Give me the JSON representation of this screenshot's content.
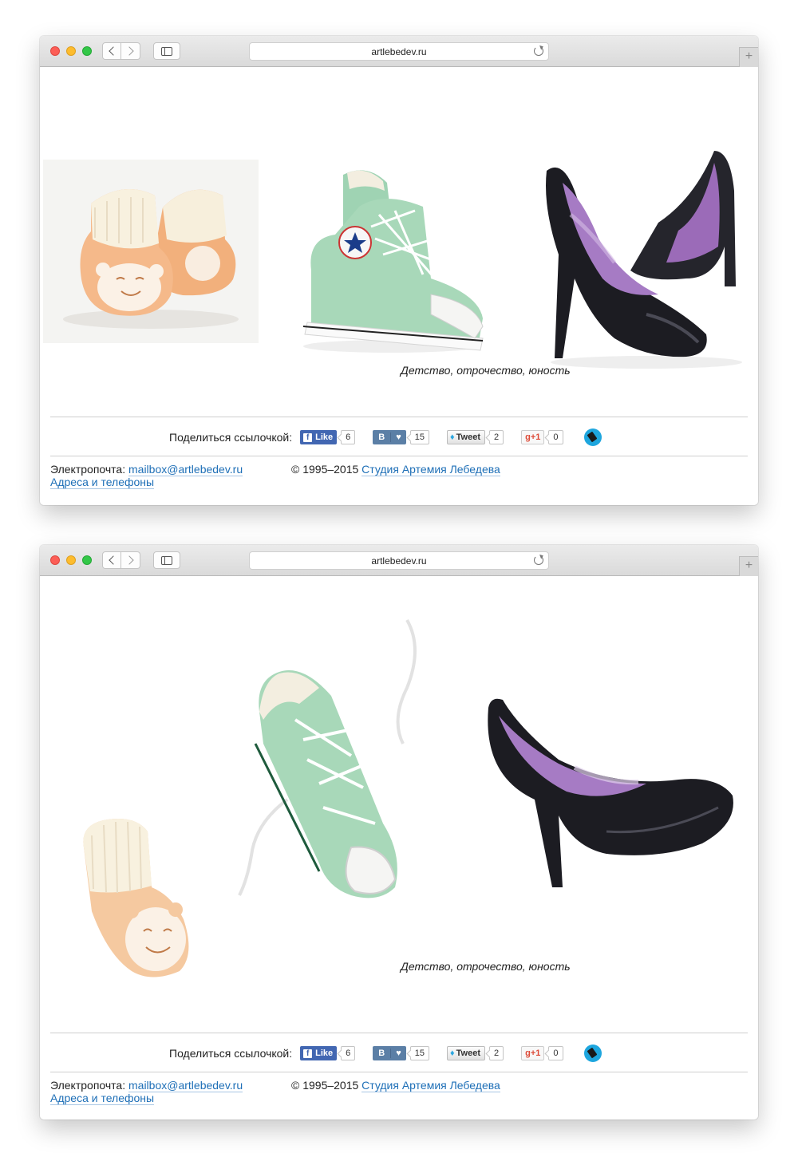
{
  "browser": {
    "url": "artlebedev.ru",
    "new_tab_label": "+"
  },
  "page": {
    "caption": "Детство, отрочество, юность",
    "share": {
      "label": "Поделиться ссылочкой:",
      "facebook": {
        "label": "Like",
        "icon": "f",
        "count": "6"
      },
      "vkontakte": {
        "label": "В",
        "icon": "heart-icon",
        "heart": "♥",
        "count": "15"
      },
      "twitter": {
        "label": "Tweet",
        "icon": "twitter-bird-icon",
        "count": "2"
      },
      "googleplus": {
        "label": "g+1",
        "count": "0"
      },
      "livejournal": {
        "icon": "livejournal-pen-icon"
      }
    },
    "footer": {
      "email_label": "Электропочта:",
      "email": "mailbox@artlebedev.ru",
      "addresses_link": "Адреса и телефоны",
      "copyright": "© 1995–2015",
      "studio_link": "Студия Артемия Лебедева"
    }
  },
  "colors": {
    "link": "#1e6fb7",
    "facebook": "#4267b2",
    "vk": "#5b7fa6",
    "livejournal": "#1ea6de",
    "sneaker_mint": "#a8d8b9",
    "bootie_peach": "#f5b98a",
    "heel_black": "#1c1c22",
    "heel_lining": "#9b6bb8"
  }
}
